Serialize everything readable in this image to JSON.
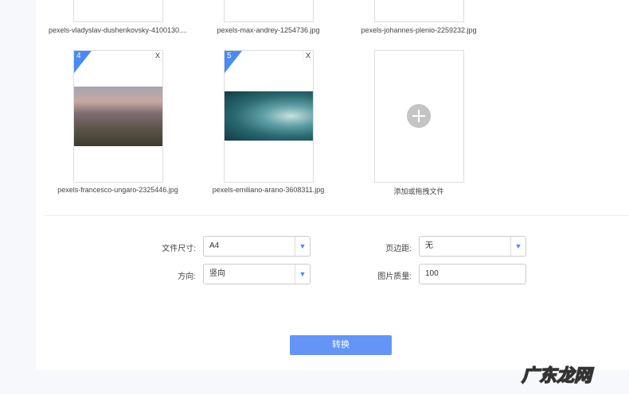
{
  "files": [
    {
      "name": "pexels-vladyslav-dushenkovsky-4100130...."
    },
    {
      "name": "pexels-max-andrey-1254736.jpg"
    },
    {
      "name": "pexels-johannes-plenio-2259232.jpg"
    },
    {
      "index": "4",
      "name": "pexels-francesco-ungaro-2325446.jpg",
      "close": "X"
    },
    {
      "index": "5",
      "name": "pexels-emiliano-arano-3608311.jpg",
      "close": "X"
    }
  ],
  "add_label": "添加或拖拽文件",
  "form": {
    "size_label": "文件尺寸:",
    "size_value": "A4",
    "margin_label": "页边距:",
    "margin_value": "无",
    "orientation_label": "方向:",
    "orientation_value": "竖向",
    "quality_label": "图片质量:",
    "quality_value": "100",
    "dropdown_arrow": "▼"
  },
  "convert_label": "转换",
  "watermark": "广东龙网"
}
